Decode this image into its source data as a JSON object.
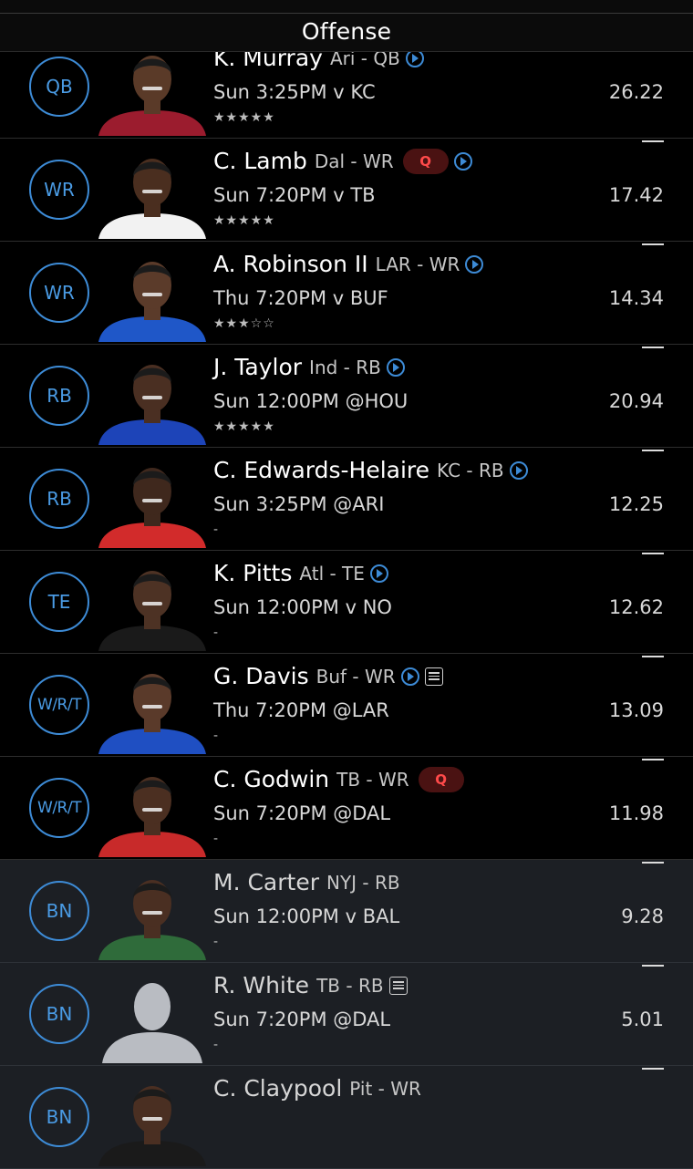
{
  "header": {
    "title": "Offense"
  },
  "colors": {
    "accent": "#3d8bd6",
    "q_badge_bg": "#4a1212",
    "q_badge_text": "#ff4a4a",
    "bench_bg": "#1c1f24"
  },
  "players": [
    {
      "slot": "QB",
      "name": "K. Murray",
      "team": "Ari - QB",
      "q": "",
      "play": true,
      "note": false,
      "game": "Sun 3:25PM v KC",
      "rating": "★★★★★",
      "points": "26.22",
      "pts_dash": "—",
      "jersey": "#9b1c2e",
      "skin": "#5a3a28",
      "bench": false
    },
    {
      "slot": "WR",
      "name": "C. Lamb",
      "team": "Dal - WR",
      "q": "Q",
      "play": true,
      "note": false,
      "game": "Sun 7:20PM v TB",
      "rating": "★★★★★",
      "points": "17.42",
      "pts_dash": "—",
      "jersey": "#f2f2f2",
      "skin": "#4a2e1f",
      "bench": false
    },
    {
      "slot": "WR",
      "name": "A. Robinson II",
      "team": "LAR - WR",
      "q": "",
      "play": true,
      "note": false,
      "game": "Thu 7:20PM v BUF",
      "rating": "★★★☆☆",
      "points": "14.34",
      "pts_dash": "—",
      "jersey": "#1f57c8",
      "skin": "#5b3b2a",
      "bench": false
    },
    {
      "slot": "RB",
      "name": "J. Taylor",
      "team": "Ind - RB",
      "q": "",
      "play": true,
      "note": false,
      "game": "Sun 12:00PM @HOU",
      "rating": "★★★★★",
      "points": "20.94",
      "pts_dash": "—",
      "jersey": "#1d44b8",
      "skin": "#4a2f22",
      "bench": false
    },
    {
      "slot": "RB",
      "name": "C. Edwards-Helaire",
      "team": "KC - RB",
      "q": "",
      "play": true,
      "note": false,
      "game": "Sun 3:25PM @ARI",
      "rating": "-",
      "points": "12.25",
      "pts_dash": "—",
      "jersey": "#d22b2b",
      "skin": "#3f281d",
      "bench": false
    },
    {
      "slot": "TE",
      "name": "K. Pitts",
      "team": "Atl - TE",
      "q": "",
      "play": true,
      "note": false,
      "game": "Sun 12:00PM v NO",
      "rating": "-",
      "points": "12.62",
      "pts_dash": "—",
      "jersey": "#1a1a1a",
      "skin": "#4d3224",
      "bench": false
    },
    {
      "slot": "W/R/T",
      "name": "G. Davis",
      "team": "Buf - WR",
      "q": "",
      "play": true,
      "note": true,
      "game": "Thu 7:20PM @LAR",
      "rating": "-",
      "points": "13.09",
      "pts_dash": "—",
      "jersey": "#1f4fc2",
      "skin": "#5a3a2a",
      "bench": false
    },
    {
      "slot": "W/R/T",
      "name": "C. Godwin",
      "team": "TB - WR",
      "q": "Q",
      "play": false,
      "note": false,
      "game": "Sun 7:20PM @DAL",
      "rating": "-",
      "points": "11.98",
      "pts_dash": "—",
      "jersey": "#c82a2a",
      "skin": "#4b2f21",
      "bench": false
    },
    {
      "slot": "BN",
      "name": "M. Carter",
      "team": "NYJ - RB",
      "q": "",
      "play": false,
      "note": false,
      "game": "Sun 12:00PM v BAL",
      "rating": "-",
      "points": "9.28",
      "pts_dash": "—",
      "jersey": "#2f6b3a",
      "skin": "#4a2f22",
      "bench": true
    },
    {
      "slot": "BN",
      "name": "R. White",
      "team": "TB - RB",
      "q": "",
      "play": false,
      "note": true,
      "game": "Sun 7:20PM @DAL",
      "rating": "-",
      "points": "5.01",
      "pts_dash": "—",
      "jersey": "",
      "skin": "",
      "bench": true
    },
    {
      "slot": "BN",
      "name": "C. Claypool",
      "team": "Pit - WR",
      "q": "",
      "play": false,
      "note": false,
      "game": "",
      "rating": "",
      "points": "",
      "pts_dash": "—",
      "jersey": "#1a1a1a",
      "skin": "#4a2f22",
      "bench": true
    }
  ]
}
